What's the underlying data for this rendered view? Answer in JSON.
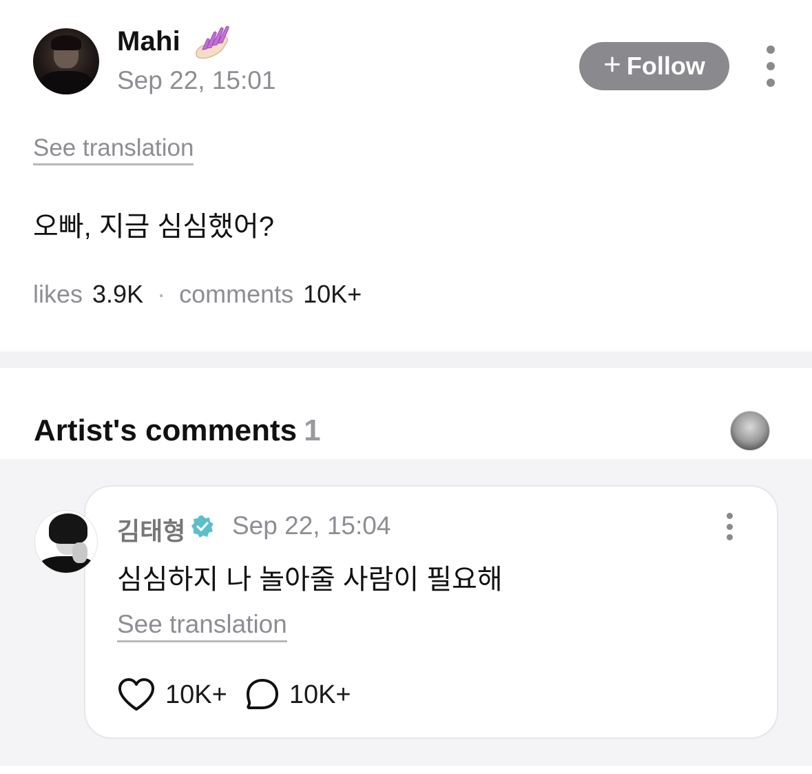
{
  "post": {
    "author": "Mahi",
    "author_emoji": "nail-polish-icon",
    "time": "Sep 22, 15:01",
    "follow_label": "Follow",
    "see_translation": "See translation",
    "body": "오빠, 지금 심심했어?",
    "likes_label": "likes",
    "likes_value": "3.9K",
    "separator": "·",
    "comments_label": "comments",
    "comments_value": "10K+"
  },
  "artist_comments": {
    "title": "Artist's comments",
    "count": "1",
    "comment": {
      "author": "김태형",
      "verified": true,
      "time": "Sep 22, 15:04",
      "text": "심심하지 나 놀아줄 사람이 필요해",
      "see_translation": "See translation",
      "likes": "10K+",
      "replies": "10K+"
    }
  },
  "colors": {
    "follow_bg": "#8a8a8e",
    "verified": "#5bbfc9",
    "muted_text": "#8d8d93",
    "section_bg": "#f4f4f6"
  }
}
